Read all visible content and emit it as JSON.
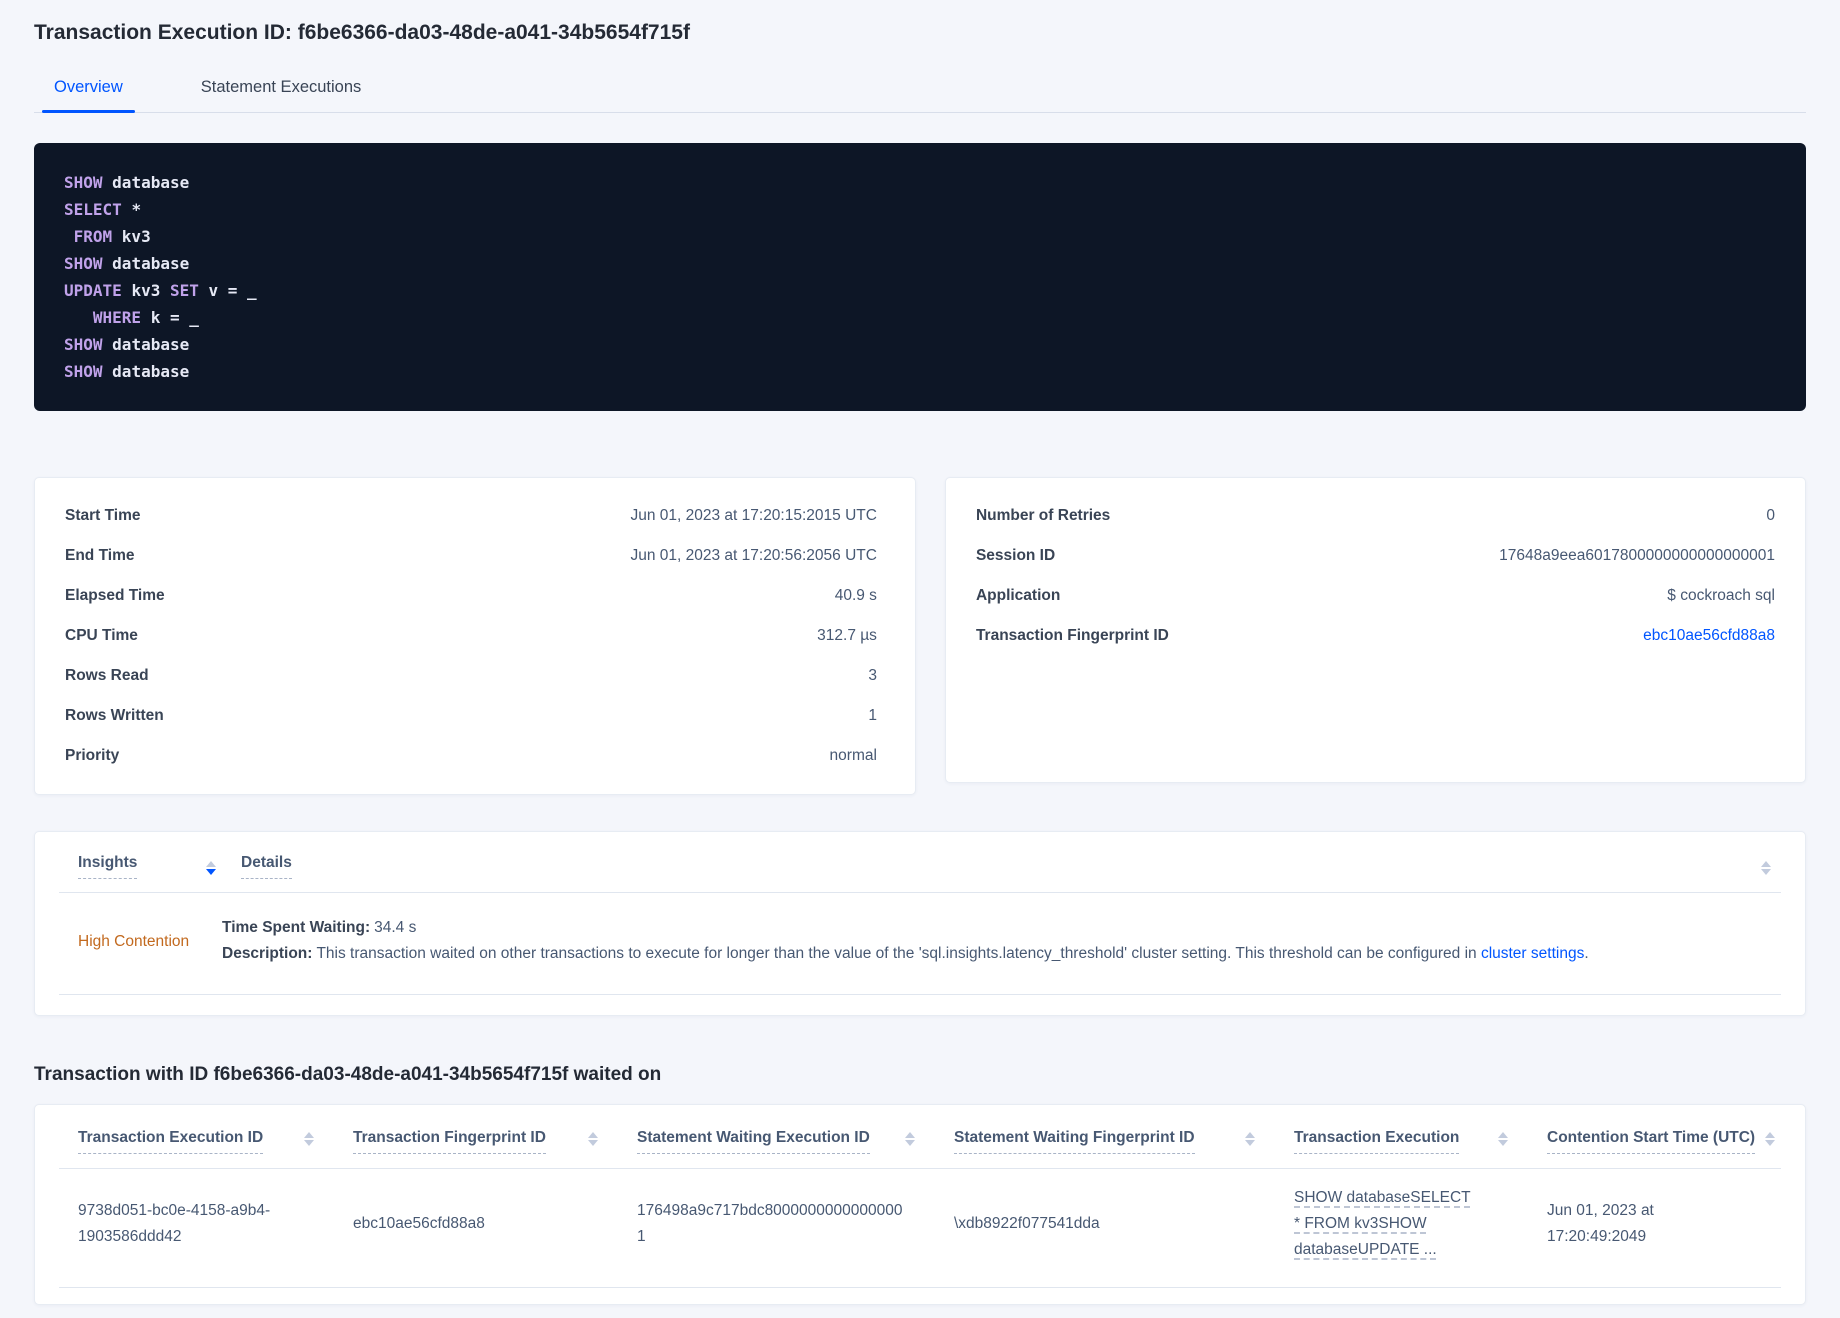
{
  "header": {
    "title": "Transaction Execution ID: f6be6366-da03-48de-a041-34b5654f715f"
  },
  "tabs": {
    "items": [
      {
        "label": "Overview"
      },
      {
        "label": "Statement Executions"
      }
    ],
    "active_index": 0
  },
  "sql": {
    "lines": [
      {
        "segments": [
          {
            "text": "SHOW ",
            "kw": true
          },
          {
            "text": "database",
            "kw": false
          }
        ]
      },
      {
        "segments": [
          {
            "text": "SELECT ",
            "kw": true
          },
          {
            "text": "*",
            "kw": false
          }
        ]
      },
      {
        "segments": [
          {
            "text": " FROM ",
            "kw": true
          },
          {
            "text": "kv3",
            "kw": false
          }
        ]
      },
      {
        "segments": [
          {
            "text": "SHOW ",
            "kw": true
          },
          {
            "text": "database",
            "kw": false
          }
        ]
      },
      {
        "segments": [
          {
            "text": "UPDATE ",
            "kw": true
          },
          {
            "text": "kv3 ",
            "kw": false
          },
          {
            "text": "SET ",
            "kw": true
          },
          {
            "text": "v = _",
            "kw": false
          }
        ]
      },
      {
        "segments": [
          {
            "text": "   WHERE ",
            "kw": true
          },
          {
            "text": "k = _",
            "kw": false
          }
        ]
      },
      {
        "segments": [
          {
            "text": "SHOW ",
            "kw": true
          },
          {
            "text": "database",
            "kw": false
          }
        ]
      },
      {
        "segments": [
          {
            "text": "SHOW ",
            "kw": true
          },
          {
            "text": "database",
            "kw": false
          }
        ]
      }
    ]
  },
  "summary_left": {
    "rows": [
      {
        "label": "Start Time",
        "value": "Jun 01, 2023 at 17:20:15:2015 UTC"
      },
      {
        "label": "End Time",
        "value": "Jun 01, 2023 at 17:20:56:2056 UTC"
      },
      {
        "label": "Elapsed Time",
        "value": "40.9 s"
      },
      {
        "label": "CPU Time",
        "value": "312.7 µs"
      },
      {
        "label": "Rows Read",
        "value": "3"
      },
      {
        "label": "Rows Written",
        "value": "1"
      },
      {
        "label": "Priority",
        "value": "normal"
      }
    ]
  },
  "summary_right": {
    "rows": [
      {
        "label": "Number of Retries",
        "value": "0"
      },
      {
        "label": "Session ID",
        "value": "17648a9eea6017800000000000000001"
      },
      {
        "label": "Application",
        "value": "$ cockroach sql"
      },
      {
        "label": "Transaction Fingerprint ID",
        "value": "ebc10ae56cfd88a8",
        "link": true
      }
    ]
  },
  "insights": {
    "columns": [
      {
        "label": "Insights",
        "sorted": "desc"
      },
      {
        "label": "Details",
        "sorted": null
      }
    ],
    "rows": [
      {
        "insight": "High Contention",
        "time_spent_waiting_label": "Time Spent Waiting:",
        "time_spent_waiting_value": "34.4 s",
        "description_label": "Description:",
        "description_text": "This transaction waited on other transactions to execute for longer than the value of the 'sql.insights.latency_threshold' cluster setting. This threshold can be configured in ",
        "description_link": "cluster settings",
        "description_suffix": "."
      }
    ]
  },
  "waited_on": {
    "heading": "Transaction with ID f6be6366-da03-48de-a041-34b5654f715f waited on",
    "columns": [
      "Transaction Execution ID",
      "Transaction Fingerprint ID",
      "Statement Waiting Execution ID",
      "Statement Waiting Fingerprint ID",
      "Transaction Execution",
      "Contention Start Time (UTC)"
    ],
    "rows": [
      {
        "transaction_execution_id": "9738d051-bc0e-4158-a9b4-1903586ddd42",
        "transaction_fingerprint_id": "ebc10ae56cfd88a8",
        "statement_waiting_execution_id": "176498a9c717bdc80000000000000001",
        "statement_waiting_fingerprint_id": "\\xdb8922f077541dda",
        "transaction_execution": "SHOW databaseSELECT * FROM kv3SHOW databaseUPDATE ...",
        "contention_start_time": "Jun 01, 2023 at 17:20:49:2049"
      }
    ]
  },
  "colors": {
    "accent_blue": "#0055ff",
    "high_contention_orange": "#c2691e",
    "code_background": "#0d1626",
    "code_keyword": "#c0a2ea",
    "code_identifier": "#e6e9f5",
    "page_background": "#f4f6fb"
  }
}
